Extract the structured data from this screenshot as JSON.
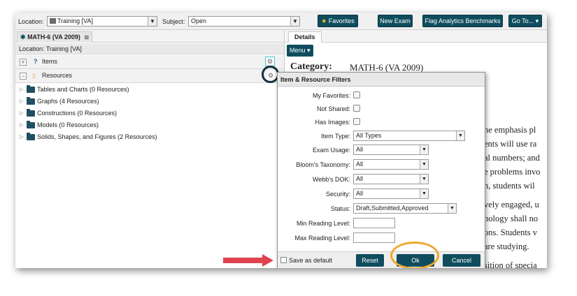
{
  "toolbar": {
    "location_label": "Location:",
    "location_value": "Training [VA]",
    "subject_label": "Subject:",
    "subject_value": "Open",
    "favorites": "Favorites",
    "new_exam": "New Exam",
    "flag_analytics": "Flag Analytics Benchmarks",
    "goto": "Go To..."
  },
  "left_panel": {
    "tab_title": "MATH-6 (VA 2009)",
    "location_text": "Location: Training [VA]",
    "items_label": "Items",
    "resources_label": "Resources",
    "tree": [
      "Tables and Charts (0 Resources)",
      "Graphs (4 Resources)",
      "Constructions (0 Resources)",
      "Models (0 Resources)",
      "Solids, Shapes, and Figures (2 Resources)"
    ]
  },
  "right_panel": {
    "details_tab": "Details",
    "menu_label": "Menu",
    "category_label": "Category:",
    "category_value": "MATH-6 (VA 2009)",
    "body_fragments": [
      "he emphasis pl",
      "ents will use ra",
      "al numbers; and",
      "e problems invo",
      "n, students wil",
      "vely engaged, u",
      "nology shall no",
      "ons. Students v",
      "are studying.",
      "sition of specia"
    ]
  },
  "dialog": {
    "title": "Item & Resource Filters",
    "my_favorites": "My Favorites:",
    "not_shared": "Not Shared:",
    "has_images": "Has Images:",
    "item_type_label": "Item Type:",
    "item_type_value": "All Types",
    "exam_usage_label": "Exam Usage:",
    "exam_usage_value": "All",
    "blooms_label": "Bloom's Taxonomy:",
    "blooms_value": "All",
    "webbs_label": "Webb's DOK:",
    "webbs_value": "All",
    "security_label": "Security:",
    "security_value": "All",
    "status_label": "Status:",
    "status_value": "Draft,Submitted,Approved",
    "min_reading_label": "Min Reading Level:",
    "max_reading_label": "Max Reading Level:",
    "save_default": "Save as default",
    "reset": "Reset",
    "ok": "Ok",
    "cancel": "Cancel"
  },
  "colors": {
    "primary_button": "#0f4d5e",
    "arrow_annotation": "#e0434e",
    "highlight_circle": "#f0a830",
    "dark_circle": "#13303c"
  }
}
